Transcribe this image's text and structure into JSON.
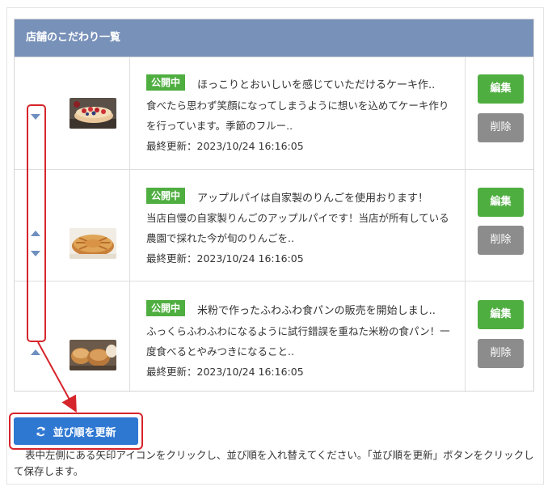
{
  "panel": {
    "header_title": "店舗のこだわり一覧"
  },
  "rows": [
    {
      "badge": "公開中",
      "title": "ほっこりとおいしいを感じていただけるケーキ作..",
      "desc": "食べたら思わず笑顔になってしまうように想いを込めてケーキ作りを行っています。季節のフルー..",
      "updated": "最終更新：2023/10/24 16:16:05",
      "edit_label": "編集",
      "delete_label": "削除",
      "thumb_icon": "cake-photo"
    },
    {
      "badge": "公開中",
      "title": "アップルパイは自家製のりんごを使用おります！",
      "desc": "当店自慢の自家製りんごのアップルパイです！当店が所有している農園で採れた今が旬のりんごを..",
      "updated": "最終更新：2023/10/24 16:16:05",
      "edit_label": "編集",
      "delete_label": "削除",
      "thumb_icon": "apple-pie-photo"
    },
    {
      "badge": "公開中",
      "title": "米粉で作ったふわふわ食パンの販売を開始しまし..",
      "desc": "ふっくらふわふわになるように試行錯誤を重ねた米粉の食パン！一度食べるとやみつきになること..",
      "updated": "最終更新：2023/10/24 16:16:05",
      "edit_label": "編集",
      "delete_label": "削除",
      "thumb_icon": "bread-photo"
    }
  ],
  "update_button": {
    "label": "並び順を更新",
    "icon": "refresh-icon"
  },
  "note": "表中左側にある矢印アイコンをクリックし、並び順を入れ替えてください。「並び順を更新」ボタンをクリックして保存します。",
  "colors": {
    "header_bg": "#7891b9",
    "badge_green": "#4fae40",
    "edit_green": "#4fae40",
    "delete_gray": "#8c8c8c",
    "update_blue": "#2f78d2",
    "highlight_red": "#d6242b",
    "arrow_blue": "#6f8fc0"
  }
}
